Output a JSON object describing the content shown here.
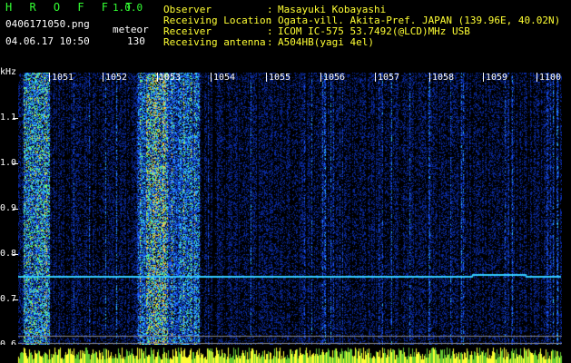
{
  "header": {
    "app_title": "H R O F F T",
    "app_version": "1.0.0",
    "filename": "0406171050.png",
    "mode": "meteor",
    "datetime": "04.06.17 10:50",
    "count": "130",
    "meta": [
      {
        "label": "Observer",
        "value": "Masayuki Kobayashi"
      },
      {
        "label": "Receiving Location",
        "value": "Ogata-vill. Akita-Pref. JAPAN (139.96E, 40.02N)"
      },
      {
        "label": "Receiver",
        "value": "ICOM IC-575 53.7492(@LCD)MHz USB"
      },
      {
        "label": "Receiving antenna",
        "value": "A504HB(yagi 4el)"
      }
    ]
  },
  "axis": {
    "unit": "kHz",
    "freq_labels": [
      "1.1",
      "1.0",
      "0.9",
      "0.8",
      "0.7",
      "0.6"
    ],
    "minute_labels": [
      "1051",
      "1052",
      "1053",
      "1054",
      "1055",
      "1056",
      "1057",
      "1058",
      "1059",
      "1100"
    ]
  },
  "colors": {
    "background": "#000000",
    "title_green": "#33ff33",
    "meta_yellow": "#ffff33",
    "noise_blue": "#0a2aa0",
    "trace_cyan": "#33ccff"
  }
}
